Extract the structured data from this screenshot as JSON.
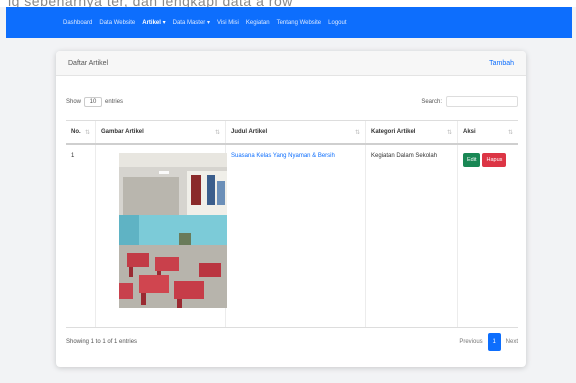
{
  "navbar": {
    "items": [
      {
        "label": "Dashboard"
      },
      {
        "label": "Data Website"
      },
      {
        "label": "Artikel ▾"
      },
      {
        "label": "Data Master ▾"
      },
      {
        "label": "Visi Misi"
      },
      {
        "label": "Kegiatan"
      },
      {
        "label": "Tentang Website"
      },
      {
        "label": "Logout"
      }
    ]
  },
  "card": {
    "title": "Daftar Artikel",
    "add_label": "Tambah"
  },
  "controls": {
    "show_label": "Show",
    "length_value": "10",
    "entries_label": "entries",
    "search_label": "Search:",
    "search_value": ""
  },
  "table": {
    "headers": [
      "No.",
      "Gambar Artikel",
      "Judul Artikel",
      "Kategori Artikel",
      "Aksi"
    ],
    "rows": [
      {
        "no": "1",
        "title": "Suasana Kelas Yang Nyaman & Bersih",
        "category": "Kegiatan Dalam Sekolah",
        "edit_label": "Edit",
        "delete_label": "Hapus"
      }
    ]
  },
  "footer": {
    "info": "Showing 1 to 1 of 1 entries",
    "previous_label": "Previous",
    "page": "1",
    "next_label": "Next"
  }
}
